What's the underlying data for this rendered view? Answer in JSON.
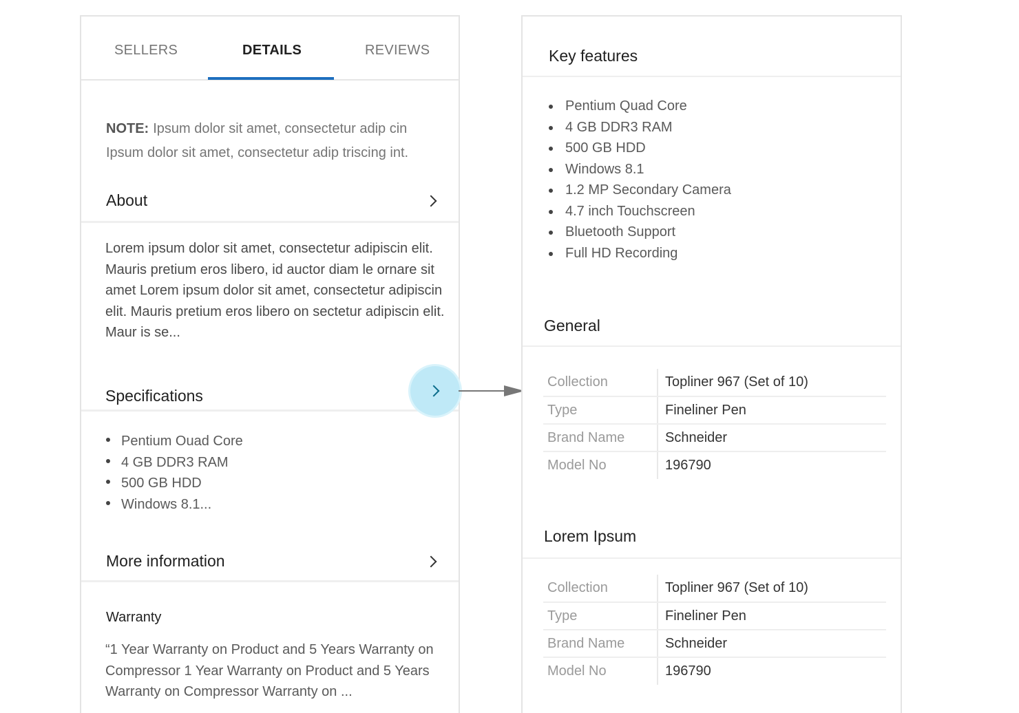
{
  "tabs": [
    {
      "label": "SELLERS"
    },
    {
      "label": "DETAILS"
    },
    {
      "label": "REVIEWS"
    }
  ],
  "active_tab": "DETAILS",
  "note": {
    "label": "NOTE:",
    "text": "Ipsum dolor sit amet, consectetur adip cin Ipsum dolor sit amet, consectetur adip triscing int."
  },
  "about": {
    "title": "About",
    "text": "Lorem ipsum dolor sit amet, consectetur adipiscin elit. Mauris pretium eros libero, id auctor diam le ornare sit amet Lorem ipsum dolor sit amet, consectetur adipiscin elit. Mauris pretium eros libero on sectetur adipiscin elit. Maur is se..."
  },
  "specifications": {
    "title": "Specifications",
    "items": [
      "Pentium Ouad Core",
      "4 GB DDR3 RAM",
      "500 GB HDD",
      "Windows 8.1..."
    ]
  },
  "more_information": {
    "title": "More information"
  },
  "warranty": {
    "title": "Warranty",
    "text": "“1 Year Warranty on Product and 5 Years Warranty on Compressor 1 Year Warranty on Product and 5 Years Warranty on Compressor Warranty on ..."
  },
  "key_features": {
    "title": "Key features",
    "items": [
      "Pentium Quad Core",
      "4 GB DDR3 RAM",
      "500 GB HDD",
      "Windows 8.1",
      "1.2 MP Secondary Camera",
      "4.7 inch Touchscreen",
      "Bluetooth Support",
      "Full HD Recording"
    ]
  },
  "general": {
    "title": "General",
    "rows": [
      {
        "key": "Collection",
        "value": "Topliner 967 (Set of 10)"
      },
      {
        "key": "Type",
        "value": "Fineliner Pen"
      },
      {
        "key": "Brand Name",
        "value": "Schneider"
      },
      {
        "key": "Model No",
        "value": "196790"
      }
    ]
  },
  "lorem_ipsum": {
    "title": "Lorem Ipsum",
    "rows": [
      {
        "key": "Collection",
        "value": "Topliner 967 (Set of 10)"
      },
      {
        "key": "Type",
        "value": "Fineliner Pen"
      },
      {
        "key": "Brand Name",
        "value": "Schneider"
      },
      {
        "key": "Model No",
        "value": "196790"
      }
    ]
  },
  "colors": {
    "accent": "#1e6fbf",
    "highlight": "#bfe9f7"
  }
}
